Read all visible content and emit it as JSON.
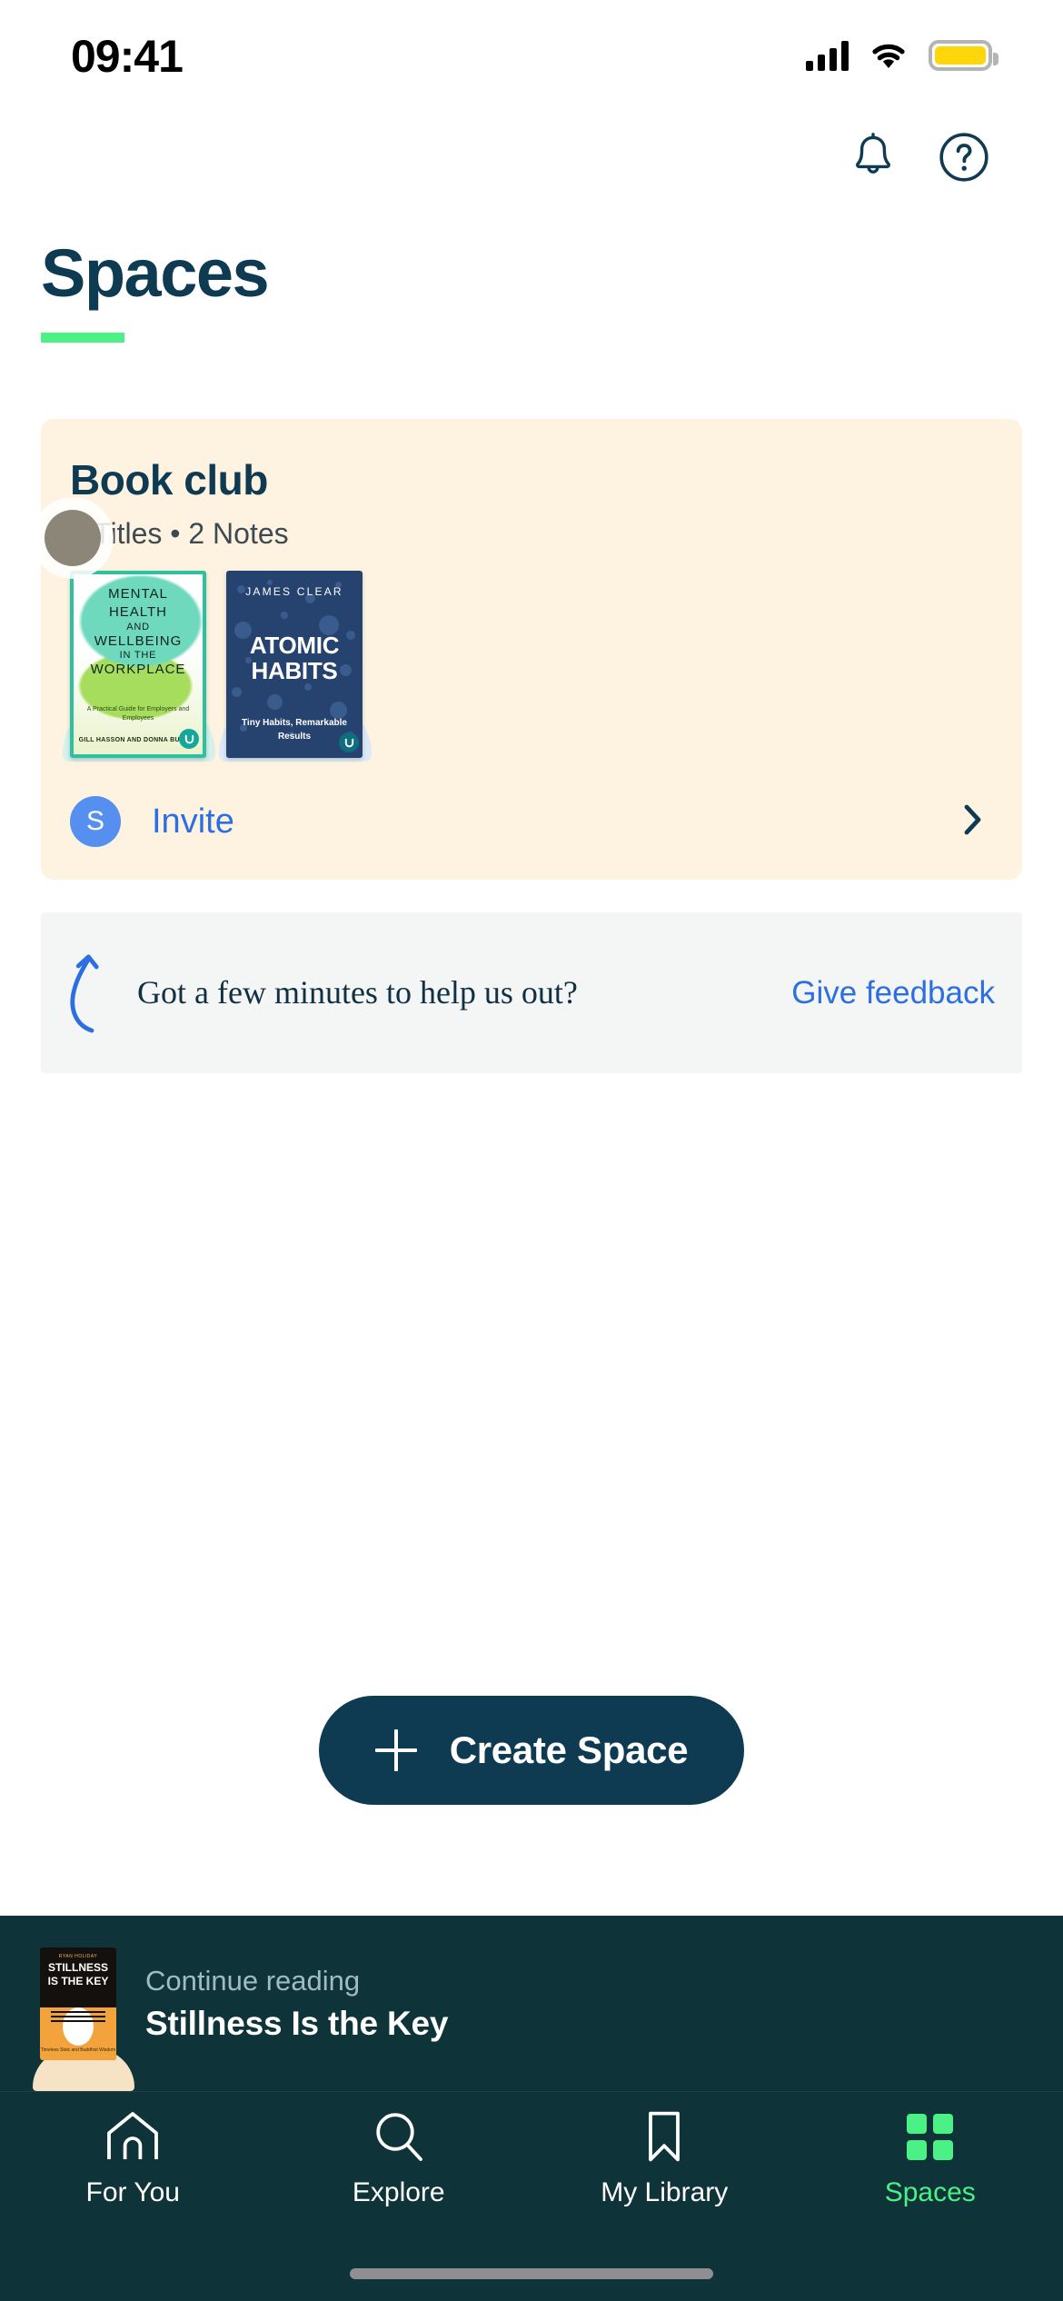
{
  "status_bar": {
    "time": "09:41",
    "signal_icon": "cellular-signal-icon",
    "wifi_icon": "wifi-icon",
    "battery_icon": "battery-icon",
    "battery_color": "#FFD60A"
  },
  "header": {
    "notifications_icon": "bell-icon",
    "help_icon": "question-circle-icon"
  },
  "page": {
    "title": "Spaces",
    "title_color": "#0E3A52",
    "accent_color": "#4BF184"
  },
  "space_card": {
    "name": "Book club",
    "meta": "2 Titles • 2 Notes",
    "background": "#FDF3E0",
    "books": [
      {
        "title_lines": [
          "MENTAL",
          "HEALTH",
          "AND",
          "WELLBEING",
          "IN THE",
          "WORKPLACE"
        ],
        "subtitle": "A Practical Guide for Employers and Employees",
        "authors": "GILL HASSON AND DONNA BUTLER",
        "badge": "library-badge-icon"
      },
      {
        "author": "JAMES CLEAR",
        "title": "ATOMIC HABITS",
        "title_line_1": "ATOMIC",
        "title_line_2": "HABITS",
        "tagline": "Tiny Habits, Remarkable Results",
        "badge": "library-badge-icon"
      }
    ],
    "member_initial": "S",
    "invite_label": "Invite",
    "invite_color": "#2D6FE0",
    "chevron_icon": "chevron-right-icon"
  },
  "feedback_banner": {
    "arrow_icon": "curved-arrow-icon",
    "message": "Got a few minutes to help us out?",
    "link_label": "Give feedback",
    "link_color": "#2D6FE0",
    "background": "#F3F6F5"
  },
  "create_space": {
    "label": "Create Space",
    "plus_icon": "plus-icon",
    "background": "#0E3A52"
  },
  "continue_reading": {
    "label": "Continue reading",
    "title": "Stillness Is the Key",
    "cover": {
      "author": "RYAN HOLIDAY",
      "title_line_1": "STILLNESS",
      "title_line_2": "IS THE KEY",
      "subtitle": "Timeless Stoic and Buddhist Wisdom"
    },
    "background": "#0E3338"
  },
  "tab_bar": {
    "background": "#0E3338",
    "active_color": "#4BF184",
    "items": [
      {
        "label": "For You",
        "icon": "home-icon",
        "active": false
      },
      {
        "label": "Explore",
        "icon": "search-icon",
        "active": false
      },
      {
        "label": "My Library",
        "icon": "bookmark-icon",
        "active": false
      },
      {
        "label": "Spaces",
        "icon": "grid-icon",
        "active": true
      }
    ]
  }
}
